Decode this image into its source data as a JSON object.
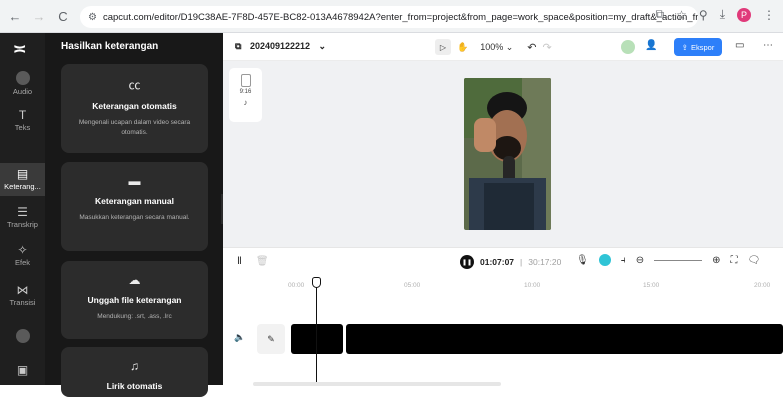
{
  "browser": {
    "url": "capcut.com/editor/D19C38AE-7F8D-457E-BC82-013A4678942A?enter_from=project&from_page=work_space&position=my_draft&_action_fr...",
    "profile_initial": "P"
  },
  "rail": {
    "items": [
      {
        "label": "Audio",
        "icon": "music-note-icon"
      },
      {
        "label": "Teks",
        "icon": "text-t-icon"
      },
      {
        "label": "Keterang...",
        "icon": "captions-icon"
      },
      {
        "label": "Transkrip",
        "icon": "transcript-icon"
      },
      {
        "label": "Efek",
        "icon": "effects-icon"
      },
      {
        "label": "Transisi",
        "icon": "transition-icon"
      }
    ]
  },
  "panel": {
    "title": "Hasilkan keterangan",
    "cards": [
      {
        "title": "Keterangan otomatis",
        "desc": "Mengenali ucapan dalam video secara otomatis."
      },
      {
        "title": "Keterangan manual",
        "desc": "Masukkan keterangan secara manual."
      },
      {
        "title": "Unggah file keterangan",
        "desc": "Mendukung: .srt, .ass, .lrc"
      },
      {
        "title": "Lirik otomatis",
        "desc": ""
      }
    ]
  },
  "topbar": {
    "project_name": "202409122212",
    "zoom": "100%",
    "export_label": "Ekspor"
  },
  "canvas": {
    "ratio": "9:16"
  },
  "timeline": {
    "current_time": "01:07:07",
    "separator": "|",
    "total_time": "30:17:20",
    "ruler_ticks": [
      "00:00",
      "05:00",
      "10:00",
      "15:00",
      "20:00"
    ]
  },
  "colors": {
    "accent": "#2d7ff9",
    "rail_bg": "#1f1f1f",
    "panel_bg": "#181818",
    "card_bg": "#2c2c2c",
    "canvas_bg": "#f0f1f3"
  }
}
